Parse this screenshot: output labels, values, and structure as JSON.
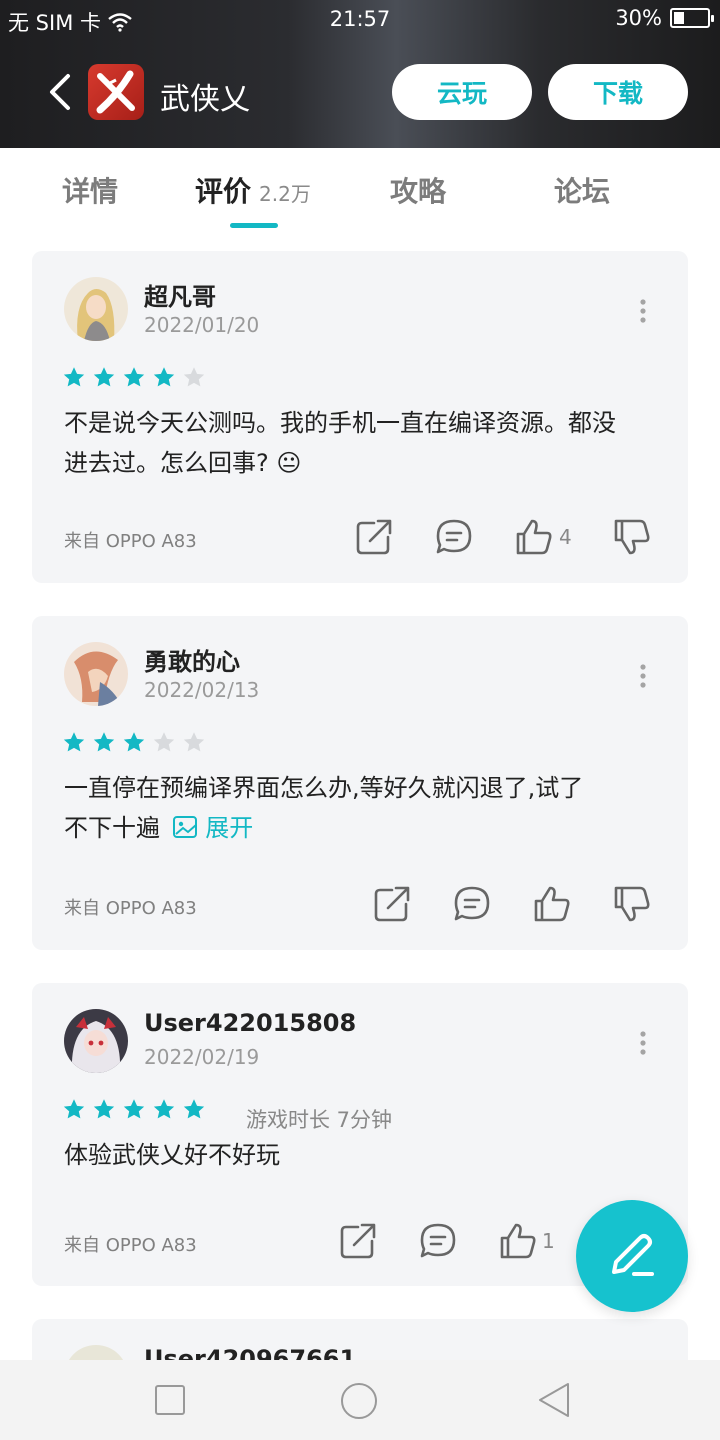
{
  "status_bar": {
    "carrier": "无 SIM 卡",
    "time": "21:57",
    "battery": "30%",
    "battery_level": 0.3
  },
  "header": {
    "app_name": "武侠乂",
    "cloud_play_label": "云玩",
    "download_label": "下载"
  },
  "tabs": [
    {
      "label": "详情"
    },
    {
      "label": "评价",
      "count": "2.2万"
    },
    {
      "label": "攻略"
    },
    {
      "label": "论坛"
    }
  ],
  "active_tab": "评价",
  "reviews": [
    {
      "user": "超凡哥",
      "date": "2022/01/20",
      "stars": 4,
      "text_line1": "不是说今天公测吗。我的手机一直在编译资源。都没",
      "text_line2": "进去过。怎么回事?",
      "emoji": "😐",
      "source": "来自 OPPO A83",
      "likes": "4"
    },
    {
      "user": "勇敢的心",
      "date": "2022/02/13",
      "stars": 3,
      "text_line1": "一直停在预编译界面怎么办,等好久就闪退了,试了",
      "text_line2": "不下十遍",
      "expand_label": "展开",
      "source": "来自 OPPO A83"
    },
    {
      "user": "User422015808",
      "date": "2022/02/19",
      "stars": 5,
      "playtime": "游戏时长 7分钟",
      "text_line1": "体验武侠乂好不好玩",
      "source": "来自 OPPO A83",
      "likes": "1"
    },
    {
      "user": "User420967661"
    }
  ],
  "colors": {
    "accent": "#13b8c4",
    "star_on": "#13b8c4",
    "star_off": "#d8dadd",
    "card_bg": "#f4f5f7"
  }
}
